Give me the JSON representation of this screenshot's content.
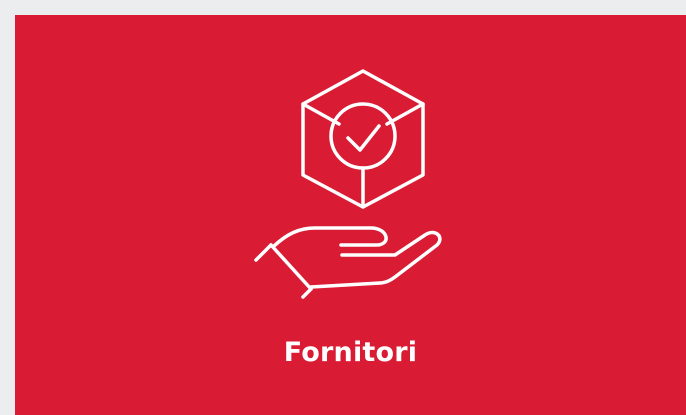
{
  "card": {
    "label": "Fornitori",
    "background_color": "#d91b33",
    "page_background_color": "#ebedef",
    "foreground_color": "#ffffff",
    "icons": [
      "box-check-icon",
      "open-hand-icon"
    ]
  }
}
